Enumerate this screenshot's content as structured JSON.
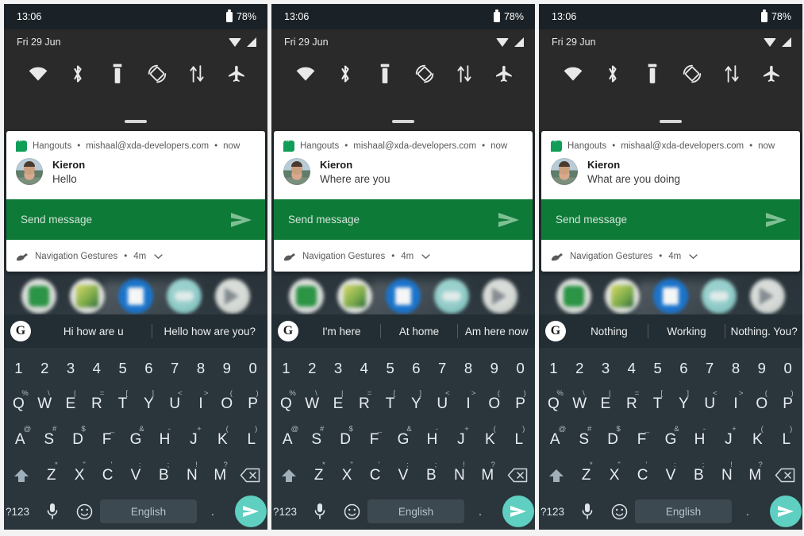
{
  "meta": {
    "panel_count": 3,
    "colors": {
      "statusbar_bg": "#1b2227",
      "shade_bg": "#2a2a2a",
      "reply_green": "#0e7a38",
      "keyboard_bg": "#2b353c",
      "send_circle": "#5ecfc0",
      "hangouts_green": "#0f9d58"
    }
  },
  "statusbar": {
    "time": "13:06",
    "battery_percent": "78%",
    "battery_icon": "battery-icon"
  },
  "shade": {
    "date": "Fri 29 Jun",
    "signal_icons": [
      "wifi-icon",
      "cell-signal-icon"
    ],
    "handle": "shade-drag-handle",
    "quick_settings": [
      {
        "name": "wifi-tile",
        "icon": "wifi-icon",
        "label": "Wi-Fi"
      },
      {
        "name": "bluetooth-tile",
        "icon": "bluetooth-icon",
        "label": "Bluetooth"
      },
      {
        "name": "flashlight-tile",
        "icon": "flashlight-icon",
        "label": "Flashlight"
      },
      {
        "name": "auto-rotate-tile",
        "icon": "auto-rotate-icon",
        "label": "Auto-rotate"
      },
      {
        "name": "mobile-data-tile",
        "icon": "data-transfer-icon",
        "label": "Mobile data"
      },
      {
        "name": "airplane-mode-tile",
        "icon": "airplane-icon",
        "label": "Airplane mode"
      }
    ]
  },
  "notification": {
    "app_name": "Hangouts",
    "account": "mishaal@xda-developers.com",
    "time": "now",
    "separator": "•",
    "app_icon": "hangouts-icon",
    "avatar": "contact-avatar",
    "sender": "Kieron",
    "reply_placeholder": "Send message",
    "send_icon": "send-icon",
    "footer_app": "Navigation Gestures",
    "footer_time": "4m",
    "footer_icon": "navigation-gestures-icon",
    "footer_chevron": "chevron-down-icon"
  },
  "keyboard": {
    "g_logo": "google-logo-icon",
    "rows": {
      "numbers": [
        "1",
        "2",
        "3",
        "4",
        "5",
        "6",
        "7",
        "8",
        "9",
        "0"
      ],
      "top": [
        {
          "key": "Q",
          "sup": "%"
        },
        {
          "key": "W",
          "sup": "\\"
        },
        {
          "key": "E",
          "sup": "|"
        },
        {
          "key": "R",
          "sup": "="
        },
        {
          "key": "T",
          "sup": "["
        },
        {
          "key": "Y",
          "sup": "]"
        },
        {
          "key": "U",
          "sup": "<"
        },
        {
          "key": "I",
          "sup": ">"
        },
        {
          "key": "O",
          "sup": "("
        },
        {
          "key": "P",
          "sup": ")"
        }
      ],
      "home": [
        {
          "key": "A",
          "sup": "@"
        },
        {
          "key": "S",
          "sup": "#"
        },
        {
          "key": "D",
          "sup": "$"
        },
        {
          "key": "F",
          "sup": "_"
        },
        {
          "key": "G",
          "sup": "&"
        },
        {
          "key": "H",
          "sup": "-"
        },
        {
          "key": "J",
          "sup": "+"
        },
        {
          "key": "K",
          "sup": "("
        },
        {
          "key": "L",
          "sup": ")"
        }
      ],
      "bottom": [
        {
          "key": "Z",
          "sup": "*"
        },
        {
          "key": "X",
          "sup": "\""
        },
        {
          "key": "C",
          "sup": "'"
        },
        {
          "key": "V",
          "sup": ":"
        },
        {
          "key": "B",
          "sup": ";"
        },
        {
          "key": "N",
          "sup": "!"
        },
        {
          "key": "M",
          "sup": "?"
        }
      ]
    },
    "shift_icon": "shift-icon",
    "backspace_icon": "backspace-icon",
    "symbols_label": "?123",
    "mic_icon": "microphone-icon",
    "emoji_icon": "emoji-icon",
    "space_label": "English",
    "period_label": ".",
    "send_icon": "send-icon"
  },
  "panels": [
    {
      "id": "panel-1",
      "message": "Hello",
      "suggestions": [
        "Hi how are u",
        "Hello how are you?"
      ]
    },
    {
      "id": "panel-2",
      "message": "Where are you",
      "suggestions": [
        "I'm here",
        "At home",
        "Am here now"
      ]
    },
    {
      "id": "panel-3",
      "message": "What are you doing",
      "suggestions": [
        "Nothing",
        "Working",
        "Nothing. You?"
      ]
    }
  ]
}
